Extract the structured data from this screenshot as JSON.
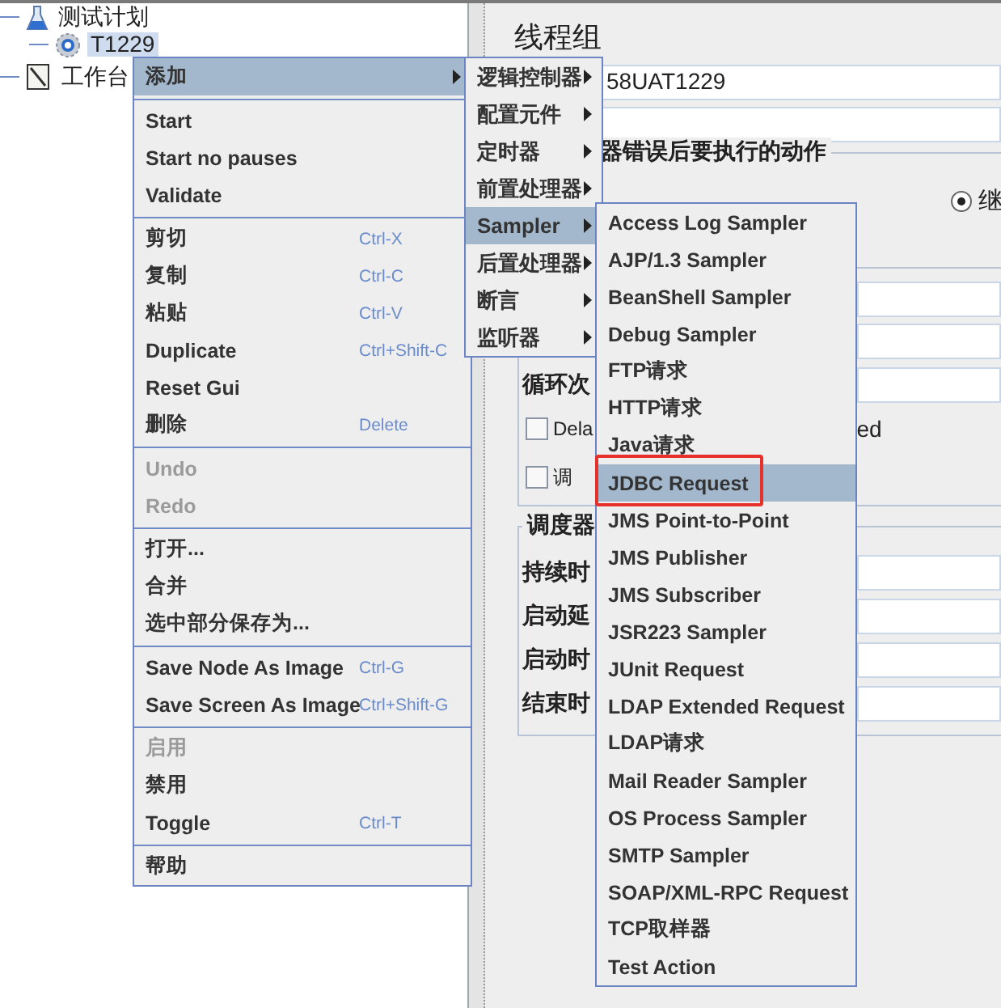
{
  "tree": {
    "items": [
      {
        "label": "测试计划",
        "selected": false
      },
      {
        "label": "T1229",
        "selected": true
      },
      {
        "label": "工作台",
        "selected": false
      }
    ]
  },
  "context_menu": {
    "groups": [
      [
        {
          "label": "添加",
          "submenu": true,
          "selected": true,
          "disabled": false
        }
      ],
      [
        {
          "label": "Start",
          "submenu": false,
          "selected": false,
          "disabled": false
        },
        {
          "label": "Start no pauses",
          "submenu": false,
          "selected": false,
          "disabled": false
        },
        {
          "label": "Validate",
          "submenu": false,
          "selected": false,
          "disabled": false
        }
      ],
      [
        {
          "label": "剪切",
          "shortcut": "Ctrl-X",
          "submenu": false,
          "selected": false,
          "disabled": false
        },
        {
          "label": "复制",
          "shortcut": "Ctrl-C",
          "submenu": false,
          "selected": false,
          "disabled": false
        },
        {
          "label": "粘贴",
          "shortcut": "Ctrl-V",
          "submenu": false,
          "selected": false,
          "disabled": false
        },
        {
          "label": "Duplicate",
          "shortcut": "Ctrl+Shift-C",
          "submenu": false,
          "selected": false,
          "disabled": false
        },
        {
          "label": "Reset Gui",
          "submenu": false,
          "selected": false,
          "disabled": false
        },
        {
          "label": "删除",
          "shortcut": "Delete",
          "submenu": false,
          "selected": false,
          "disabled": false
        }
      ],
      [
        {
          "label": "Undo",
          "submenu": false,
          "selected": false,
          "disabled": true
        },
        {
          "label": "Redo",
          "submenu": false,
          "selected": false,
          "disabled": true
        }
      ],
      [
        {
          "label": "打开...",
          "submenu": false,
          "selected": false,
          "disabled": false
        },
        {
          "label": "合并",
          "submenu": false,
          "selected": false,
          "disabled": false
        },
        {
          "label": "选中部分保存为...",
          "submenu": false,
          "selected": false,
          "disabled": false
        }
      ],
      [
        {
          "label": "Save Node As Image",
          "shortcut": "Ctrl-G",
          "submenu": false,
          "selected": false,
          "disabled": false
        },
        {
          "label": "Save Screen As Image",
          "shortcut": "Ctrl+Shift-G",
          "submenu": false,
          "selected": false,
          "disabled": false
        }
      ],
      [
        {
          "label": "启用",
          "submenu": false,
          "selected": false,
          "disabled": true
        },
        {
          "label": "禁用",
          "submenu": false,
          "selected": false,
          "disabled": false
        },
        {
          "label": "Toggle",
          "shortcut": "Ctrl-T",
          "submenu": false,
          "selected": false,
          "disabled": false
        }
      ],
      [
        {
          "label": "帮助",
          "submenu": false,
          "selected": false,
          "disabled": false
        }
      ]
    ]
  },
  "add_submenu": {
    "items": [
      {
        "label": "逻辑控制器",
        "submenu": true,
        "selected": false
      },
      {
        "label": "配置元件",
        "submenu": true,
        "selected": false
      },
      {
        "label": "定时器",
        "submenu": true,
        "selected": false
      },
      {
        "label": "前置处理器",
        "submenu": true,
        "selected": false
      },
      {
        "label": "Sampler",
        "submenu": true,
        "selected": true
      },
      {
        "label": "后置处理器",
        "submenu": true,
        "selected": false
      },
      {
        "label": "断言",
        "submenu": true,
        "selected": false
      },
      {
        "label": "监听器",
        "submenu": true,
        "selected": false
      }
    ]
  },
  "sampler_submenu": {
    "items": [
      {
        "label": "Access Log Sampler",
        "selected": false,
        "annotated": false
      },
      {
        "label": "AJP/1.3 Sampler",
        "selected": false,
        "annotated": false
      },
      {
        "label": "BeanShell Sampler",
        "selected": false,
        "annotated": false
      },
      {
        "label": "Debug Sampler",
        "selected": false,
        "annotated": false
      },
      {
        "label": "FTP请求",
        "selected": false,
        "annotated": false
      },
      {
        "label": "HTTP请求",
        "selected": false,
        "annotated": false
      },
      {
        "label": "Java请求",
        "selected": false,
        "annotated": false
      },
      {
        "label": "JDBC Request",
        "selected": true,
        "annotated": true
      },
      {
        "label": "JMS Point-to-Point",
        "selected": false,
        "annotated": false
      },
      {
        "label": "JMS Publisher",
        "selected": false,
        "annotated": false
      },
      {
        "label": "JMS Subscriber",
        "selected": false,
        "annotated": false
      },
      {
        "label": "JSR223 Sampler",
        "selected": false,
        "annotated": false
      },
      {
        "label": "JUnit Request",
        "selected": false,
        "annotated": false
      },
      {
        "label": "LDAP Extended Request",
        "selected": false,
        "annotated": false
      },
      {
        "label": "LDAP请求",
        "selected": false,
        "annotated": false
      },
      {
        "label": "Mail Reader Sampler",
        "selected": false,
        "annotated": false
      },
      {
        "label": "OS Process Sampler",
        "selected": false,
        "annotated": false
      },
      {
        "label": "SMTP Sampler",
        "selected": false,
        "annotated": false
      },
      {
        "label": "SOAP/XML-RPC Request",
        "selected": false,
        "annotated": false
      },
      {
        "label": "TCP取样器",
        "selected": false,
        "annotated": false
      },
      {
        "label": "Test Action",
        "selected": false,
        "annotated": false
      }
    ]
  },
  "panel": {
    "title": "线程组",
    "name_field": {
      "value": "58UAT1229"
    },
    "error_action_group": {
      "legend": "器错误后要执行的动作",
      "radio": {
        "label": "继",
        "selected": true
      }
    },
    "loop_label": "循环次",
    "delay_checkbox": {
      "label": "Dela",
      "label_tail": "ed",
      "checked": false
    },
    "scheduler_checkbox": {
      "label": "调",
      "checked": false
    },
    "scheduler_group": {
      "legend": "调度器",
      "rows": [
        "持续时",
        "启动延",
        "启动时",
        "结束时"
      ]
    }
  }
}
